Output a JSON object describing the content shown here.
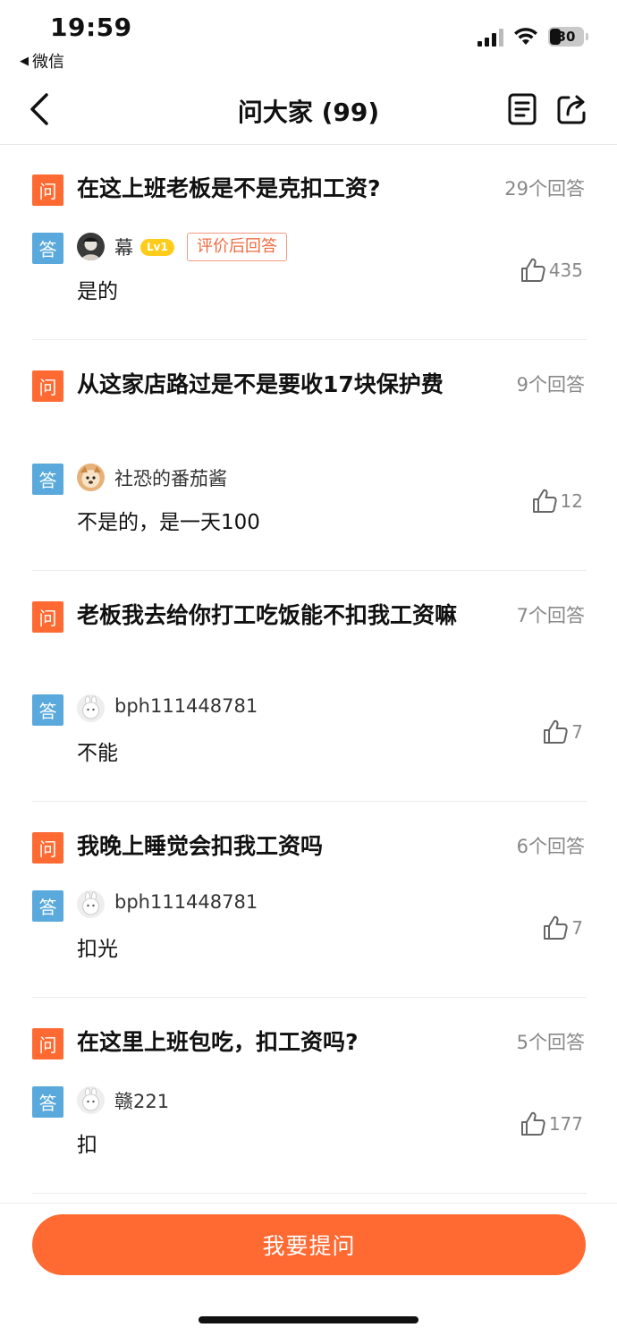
{
  "status_bar": {
    "time": "19:59",
    "back_app": "微信",
    "battery": "30"
  },
  "nav": {
    "title": "问大家 (99)",
    "icons": [
      "back-icon",
      "document-icon",
      "share-icon"
    ]
  },
  "badges": {
    "question": "问",
    "answer": "答",
    "level": "Lv1",
    "review_tag": "评价后回答"
  },
  "questions": [
    {
      "question": "在这上班老板是不是克扣工资?",
      "answer_count": "29个回答",
      "user": "幕",
      "answer": "是的",
      "likes": "435"
    },
    {
      "question": "从这家店路过是不是要收17块保护费",
      "answer_count": "9个回答",
      "user": "社恐的番茄酱",
      "answer": "不是的，是一天100",
      "likes": "12"
    },
    {
      "question": "老板我去给你打工吃饭能不扣我工资嘛",
      "answer_count": "7个回答",
      "user": "bph111448781",
      "answer": "不能",
      "likes": "7"
    },
    {
      "question": "我晚上睡觉会扣我工资吗",
      "answer_count": "6个回答",
      "user": "bph111448781",
      "answer": "扣光",
      "likes": "7"
    },
    {
      "question": "在这里上班包吃，扣工资吗?",
      "answer_count": "5个回答",
      "user": "赣221",
      "answer": "扣",
      "likes": "177"
    }
  ],
  "bottom": {
    "ask_button": "我要提问"
  },
  "colors": {
    "accent": "#ff6a33",
    "answer_badge": "#5aa9dc",
    "level_badge": "#ffcc1a"
  }
}
